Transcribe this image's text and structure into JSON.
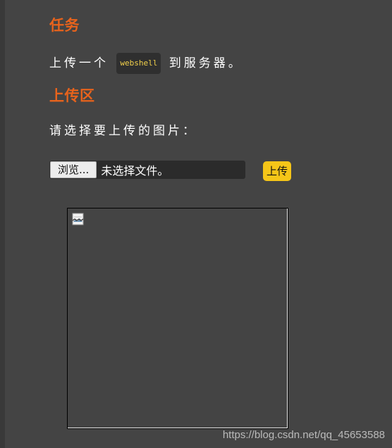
{
  "task": {
    "title": "任务",
    "text_before": "上传一个",
    "code": "webshell",
    "text_after": "到服务器。"
  },
  "upload": {
    "title": "上传区",
    "prompt": "请选择要上传的图片：",
    "browse_label": "浏览...",
    "file_status": "未选择文件。",
    "submit_label": "上传"
  },
  "preview": {
    "icon": "broken-image-icon"
  },
  "watermark": "https://blog.csdn.net/qq_45653588",
  "colors": {
    "background": "#444444",
    "heading": "#e8631c",
    "code_text": "#f1d04b",
    "upload_button": "#f5c518"
  }
}
